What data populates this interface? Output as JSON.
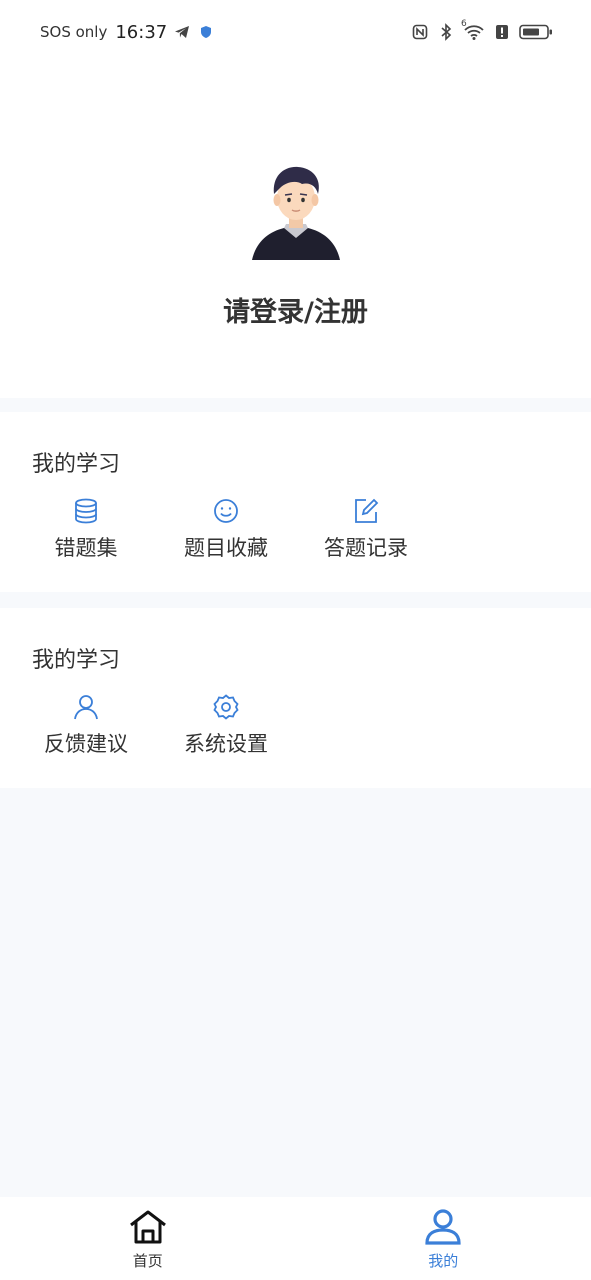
{
  "status_bar": {
    "carrier": "SOS only",
    "time": "16:37",
    "wifi_badge": "6"
  },
  "profile": {
    "login_text": "请登录/注册"
  },
  "section_study": {
    "title": "我的学习",
    "items": [
      {
        "label": "错题集",
        "icon": "database-icon"
      },
      {
        "label": "题目收藏",
        "icon": "smile-icon"
      },
      {
        "label": "答题记录",
        "icon": "edit-icon"
      }
    ]
  },
  "section_other": {
    "title": "我的学习",
    "items": [
      {
        "label": "反馈建议",
        "icon": "user-icon"
      },
      {
        "label": "系统设置",
        "icon": "gear-icon"
      }
    ]
  },
  "tabbar": {
    "tabs": [
      {
        "label": "首页",
        "icon": "home-icon",
        "active": false
      },
      {
        "label": "我的",
        "icon": "person-icon",
        "active": true
      }
    ]
  },
  "colors": {
    "accent": "#3b7fd8",
    "background": "#f7f9fc",
    "card": "#ffffff",
    "text": "#333333"
  }
}
